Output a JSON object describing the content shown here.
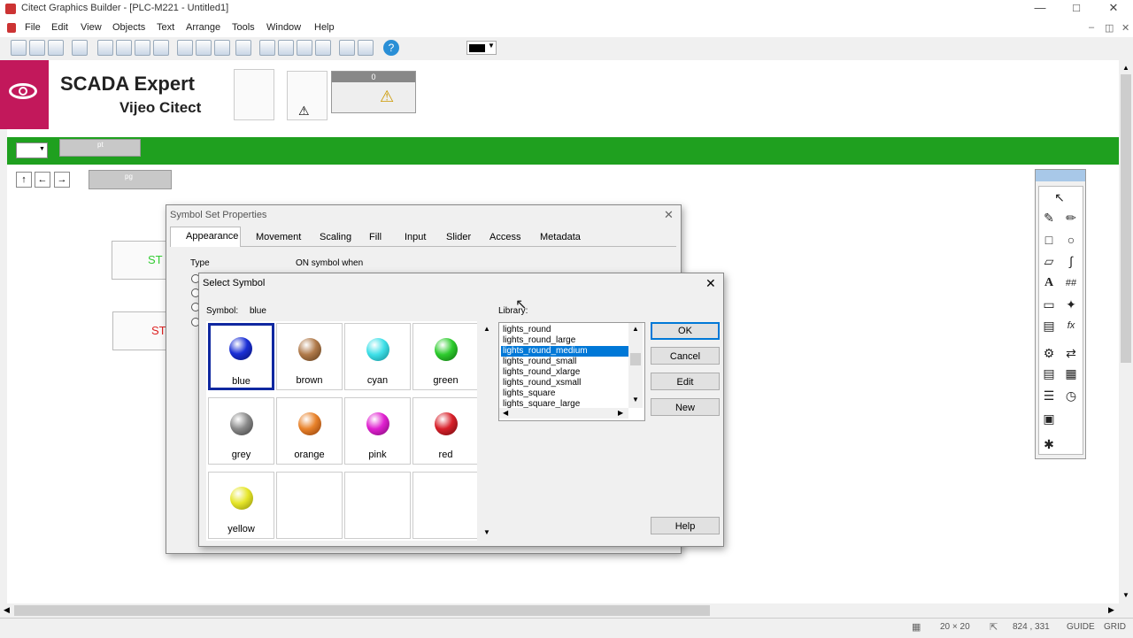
{
  "window": {
    "title": "Citect Graphics Builder - [PLC-M221 - Untitled1]"
  },
  "menu": [
    "File",
    "Edit",
    "View",
    "Objects",
    "Text",
    "Arrange",
    "Tools",
    "Window",
    "Help"
  ],
  "brand": {
    "line1": "SCADA Expert",
    "line2": "Vijeo Citect",
    "color": "#c2185b"
  },
  "colors": {
    "green_bar": "#1fa01f",
    "selection": "#0078d7"
  },
  "nav": {
    "field1": "pt",
    "field2": "pg",
    "panel_value": "0"
  },
  "canvas": {
    "btn1": "ST",
    "btn2": "ST"
  },
  "props": {
    "title": "Symbol Set Properties",
    "tabs": [
      "Appearance",
      "Movement",
      "Scaling",
      "Fill",
      "Input",
      "Slider",
      "Access",
      "Metadata"
    ],
    "type_label": "Type",
    "on_label": "ON symbol when"
  },
  "select": {
    "title": "Select Symbol",
    "symbol_label": "Symbol:",
    "symbol_value": "blue",
    "library_label": "Library:",
    "cells": [
      {
        "label": "blue",
        "color": "#1a2fd6"
      },
      {
        "label": "brown",
        "color": "#b07a4a"
      },
      {
        "label": "cyan",
        "color": "#3fe0e8"
      },
      {
        "label": "green",
        "color": "#2ecc2e"
      },
      {
        "label": "grey",
        "color": "#8a8a8a"
      },
      {
        "label": "orange",
        "color": "#e8822a"
      },
      {
        "label": "pink",
        "color": "#e020d0"
      },
      {
        "label": "red",
        "color": "#d8202a"
      },
      {
        "label": "yellow",
        "color": "#e6e62a"
      }
    ],
    "library": [
      "lights_round",
      "lights_round_large",
      "lights_round_medium",
      "lights_round_small",
      "lights_round_xlarge",
      "lights_round_xsmall",
      "lights_square",
      "lights_square_large"
    ],
    "library_selected": "lights_round_medium",
    "buttons": {
      "ok": "OK",
      "cancel": "Cancel",
      "edit": "Edit",
      "new": "New",
      "help": "Help"
    }
  },
  "status": {
    "grid_size": "20 × 20",
    "coords": "824 , 331",
    "guide": "GUIDE",
    "grid": "GRID"
  }
}
